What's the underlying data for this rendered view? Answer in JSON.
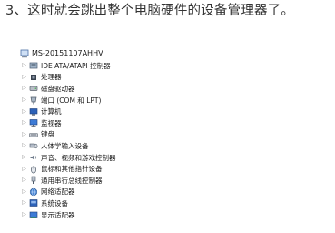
{
  "caption": "3、这时就会跳出整个电脑硬件的设备管理器了。",
  "device_manager": {
    "root": {
      "label": "MS-20151107AHHV",
      "icon": "computer-icon"
    },
    "categories": [
      {
        "label": "IDE ATA/ATAPI 控制器",
        "icon": "ide-controller-icon"
      },
      {
        "label": "处理器",
        "icon": "processor-icon"
      },
      {
        "label": "磁盘驱动器",
        "icon": "disk-drive-icon"
      },
      {
        "label": "端口 (COM 和 LPT)",
        "icon": "port-icon"
      },
      {
        "label": "计算机",
        "icon": "computer-icon"
      },
      {
        "label": "监视器",
        "icon": "monitor-icon"
      },
      {
        "label": "键盘",
        "icon": "keyboard-icon"
      },
      {
        "label": "人体学输入设备",
        "icon": "hid-icon"
      },
      {
        "label": "声音、视频和游戏控制器",
        "icon": "sound-icon"
      },
      {
        "label": "鼠标和其他指针设备",
        "icon": "mouse-icon"
      },
      {
        "label": "通用串行总线控制器",
        "icon": "usb-icon"
      },
      {
        "label": "网络适配器",
        "icon": "network-icon"
      },
      {
        "label": "系统设备",
        "icon": "system-device-icon"
      },
      {
        "label": "显示适配器",
        "icon": "display-adapter-icon"
      }
    ],
    "colors": {
      "arrow": "#8a8a8a",
      "icon_blue": "#2d62b8",
      "text": "#1a1a1a"
    }
  }
}
